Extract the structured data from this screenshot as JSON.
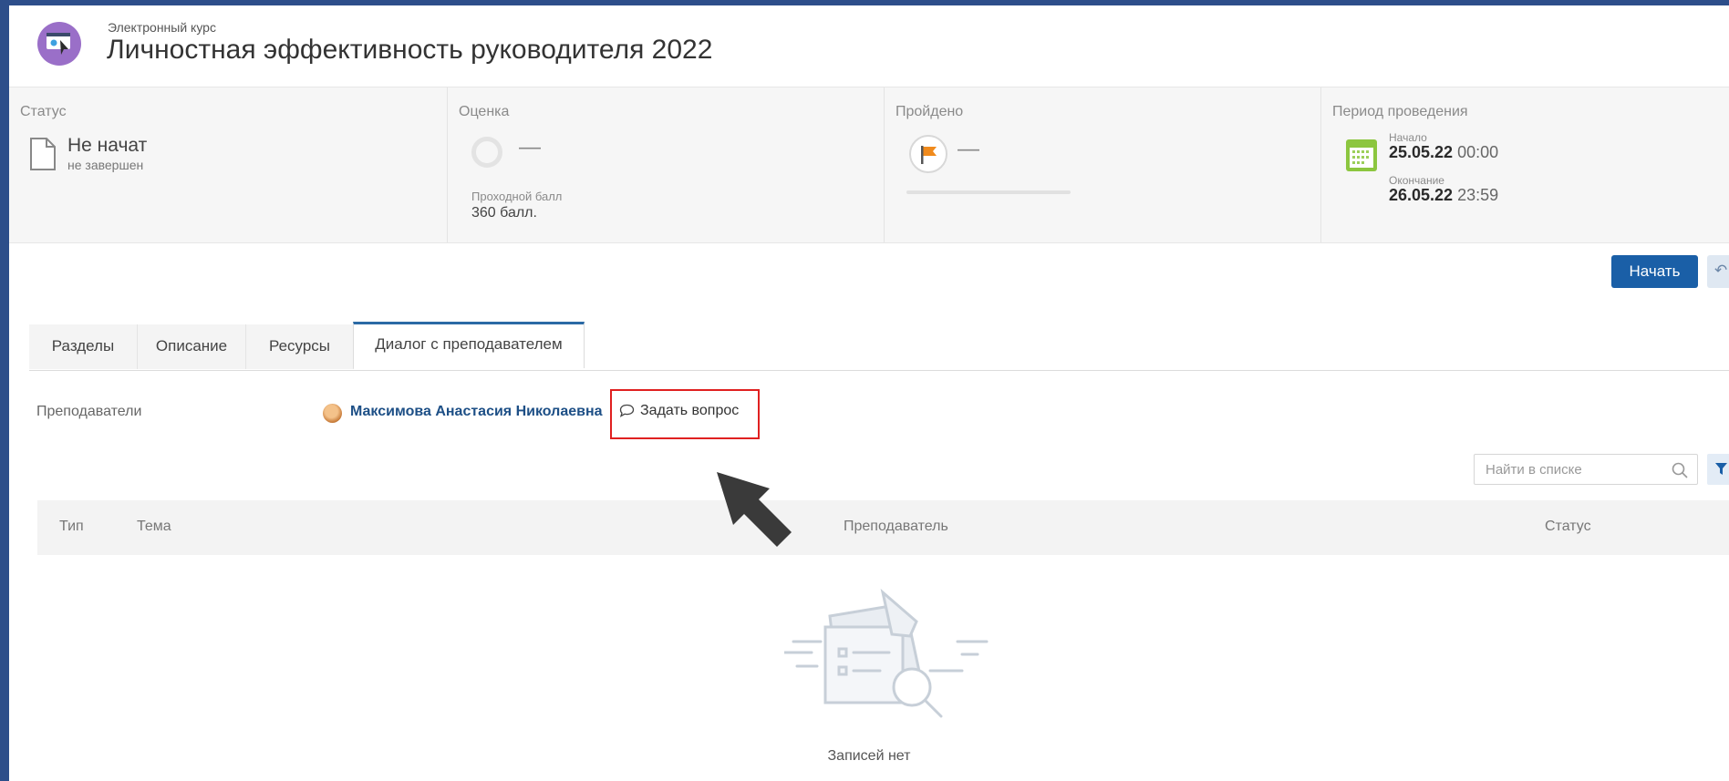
{
  "header": {
    "course_type": "Электронный курс",
    "title": "Личностная эффективность руководителя 2022"
  },
  "stats": {
    "status": {
      "label": "Статус",
      "value": "Не начат",
      "sub": "не завершен"
    },
    "grade": {
      "label": "Оценка",
      "value": "—",
      "pass_label": "Проходной балл",
      "pass_value": "360 балл."
    },
    "passed": {
      "label": "Пройдено",
      "value": "—",
      "progress": 0
    },
    "period": {
      "label": "Период проведения",
      "start_label": "Начало",
      "start_date": "25.05.22",
      "start_time": "00:00",
      "end_label": "Окончание",
      "end_date": "26.05.22",
      "end_time": "23:59"
    }
  },
  "actions": {
    "start_label": "Начать",
    "back_icon": "undo-arrow-icon"
  },
  "tabs": [
    {
      "label": "Разделы",
      "active": false
    },
    {
      "label": "Описание",
      "active": false
    },
    {
      "label": "Ресурсы",
      "active": false
    },
    {
      "label": "Диалог с преподавателем",
      "active": true
    }
  ],
  "dialog": {
    "teachers_label": "Преподаватели",
    "teacher_name": "Максимова Анастасия Николаевна",
    "ask_label": "Задать вопрос",
    "search_placeholder": "Найти в списке",
    "columns": {
      "type": "Тип",
      "topic": "Тема",
      "teacher": "Преподаватель",
      "status": "Статус"
    },
    "empty_text": "Записей нет"
  },
  "colors": {
    "accent": "#1a5fa7",
    "highlight": "#e02020",
    "frame": "#2d4e8a"
  }
}
